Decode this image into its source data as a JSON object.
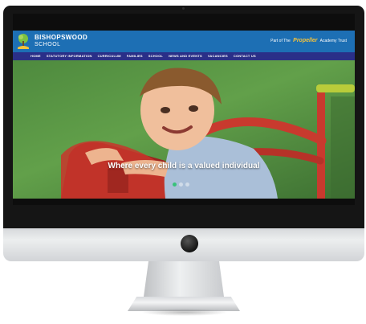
{
  "site": {
    "name_line1": "BISHOPSWOOD",
    "name_line2": "SCHOOL",
    "trust_prefix": "Part of The",
    "trust_brand": "Propeller",
    "trust_suffix": "Academy Trust"
  },
  "nav": {
    "items": [
      {
        "label": "HOME"
      },
      {
        "label": "STATUTORY INFORMATION"
      },
      {
        "label": "CURRICULUM"
      },
      {
        "label": "FAMILIES"
      },
      {
        "label": "SCHOOL"
      },
      {
        "label": "NEWS AND EVENTS"
      },
      {
        "label": "VACANCIES"
      },
      {
        "label": "CONTACT US"
      }
    ]
  },
  "hero": {
    "tagline": "Where every child is a valued individual",
    "slide_count": 3,
    "active_slide": 1
  },
  "colors": {
    "header_blue": "#1d6fb4",
    "nav_navy": "#2a2f88",
    "trust_gold": "#f5c33b",
    "slider_dot_active": "#38c27a"
  },
  "icons": {
    "school_logo": "tree-crest-icon",
    "monitor_logo": "apple-logo-icon"
  }
}
